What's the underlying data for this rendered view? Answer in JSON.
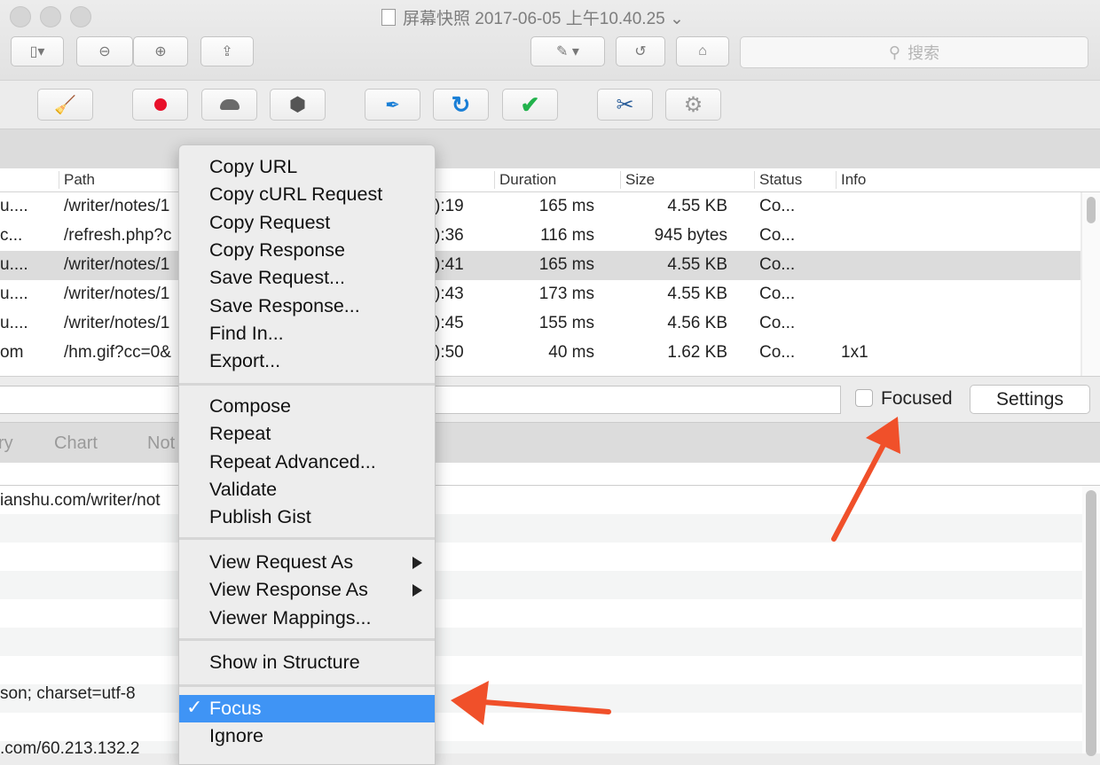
{
  "window": {
    "title": "屏幕快照 2017-06-05 上午10.40.25",
    "title_chevron": "⌄"
  },
  "toolbar": {
    "search_placeholder": "搜索"
  },
  "table": {
    "columns": [
      "Path",
      "Duration",
      "Size",
      "Status",
      "Info"
    ],
    "rows": [
      {
        "host": "u....",
        "path": "/writer/notes/1",
        "time": "):19",
        "duration": "165 ms",
        "size": "4.55 KB",
        "status": "Co...",
        "info": ""
      },
      {
        "host": "c...",
        "path": "/refresh.php?c",
        "time": "):36",
        "duration": "116 ms",
        "size": "945 bytes",
        "status": "Co...",
        "info": ""
      },
      {
        "host": "u....",
        "path": "/writer/notes/1",
        "time": "):41",
        "duration": "165 ms",
        "size": "4.55 KB",
        "status": "Co...",
        "info": ""
      },
      {
        "host": "u....",
        "path": "/writer/notes/1",
        "time": "):43",
        "duration": "173 ms",
        "size": "4.55 KB",
        "status": "Co...",
        "info": ""
      },
      {
        "host": "u....",
        "path": "/writer/notes/1",
        "time": "):45",
        "duration": "155 ms",
        "size": "4.56 KB",
        "status": "Co...",
        "info": ""
      },
      {
        "host": "om",
        "path": "/hm.gif?cc=0&",
        "time": "):50",
        "duration": "40 ms",
        "size": "1.62 KB",
        "status": "Co...",
        "info": "1x1"
      }
    ]
  },
  "filter": {
    "focused_label": "Focused",
    "settings_label": "Settings"
  },
  "tabs": [
    "ry",
    "Chart",
    "Not"
  ],
  "detail": {
    "line1": "ianshu.com/writer/not",
    "line2": "son; charset=utf-8",
    "line3": ".com/60.213.132.2"
  },
  "context_menu": {
    "group1": [
      "Copy URL",
      "Copy cURL Request",
      "Copy Request",
      "Copy Response",
      "Save Request...",
      "Save Response...",
      "Find In...",
      "Export..."
    ],
    "group2": [
      "Compose",
      "Repeat",
      "Repeat Advanced...",
      "Validate",
      "Publish Gist"
    ],
    "group3": [
      "View Request As",
      "View Response As",
      "Viewer Mappings..."
    ],
    "group4": [
      "Show in Structure"
    ],
    "group5": [
      "Focus",
      "Ignore"
    ],
    "checked_item": "Focus",
    "check_glyph": "✓"
  },
  "colors": {
    "highlight": "#3f94f5",
    "annotation_arrow": "#f0502a",
    "record_red": "#e8102a",
    "tick_green": "#22b24c",
    "refresh_blue": "#1a7fd6"
  }
}
